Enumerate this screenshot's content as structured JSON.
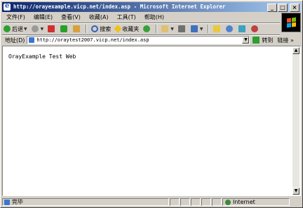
{
  "window": {
    "title": "http://orayexample.vicp.net/index.asp - Microsoft Internet Explorer",
    "buttons": {
      "minimize": "_",
      "maximize": "□",
      "close": "×"
    }
  },
  "menubar": {
    "items": [
      "文件(F)",
      "编辑(E)",
      "查看(V)",
      "收藏(A)",
      "工具(T)",
      "帮助(H)"
    ]
  },
  "toolbar": {
    "back_label": "后退",
    "search_label": "搜索",
    "favorites_label": "收藏夹"
  },
  "address": {
    "label": "地址(D)",
    "url": "http://oraytest2007.vicp.net/index.asp",
    "go_label": "转到",
    "links_label": "链接",
    "links_chevron": "»"
  },
  "page": {
    "text": "OrayExample Test Web"
  },
  "status": {
    "text": "完毕",
    "zone": "Internet"
  }
}
